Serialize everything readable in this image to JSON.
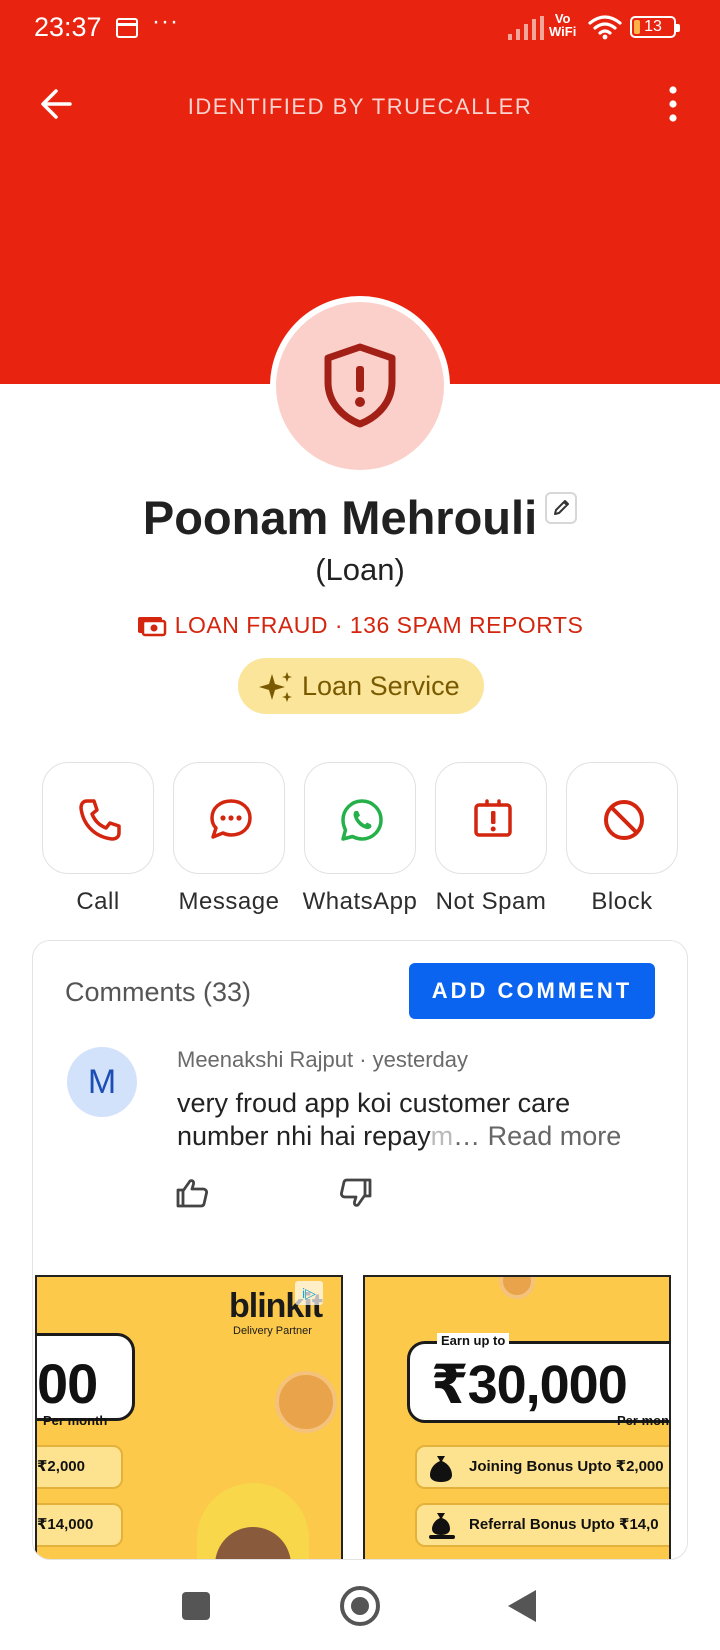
{
  "status_bar": {
    "time": "23:37",
    "overflow": "···",
    "network_label_top": "Vo",
    "network_label_bottom": "WiFi",
    "battery": "13"
  },
  "header": {
    "title": "IDENTIFIED BY TRUECALLER",
    "background_color": "#e8230f"
  },
  "profile": {
    "name": "Poonam Mehrouli",
    "subtitle": "(Loan)",
    "spam_label": "LOAN FRAUD · 136 SPAM REPORTS",
    "tag": "Loan Service",
    "avatar_icon": "shield-alert-icon"
  },
  "actions": [
    {
      "label": "Call",
      "icon": "phone-icon"
    },
    {
      "label": "Message",
      "icon": "chat-bubble-icon"
    },
    {
      "label": "WhatsApp",
      "icon": "whatsapp-icon"
    },
    {
      "label": "Not Spam",
      "icon": "not-spam-icon"
    },
    {
      "label": "Block",
      "icon": "block-icon"
    }
  ],
  "comments": {
    "title": "Comments (33)",
    "add_button": "ADD COMMENT",
    "items": [
      {
        "avatar_initial": "M",
        "author_time": "Meenakshi Rajput · yesterday",
        "text_line1": "very froud app koi customer care",
        "text_line2": "number nhi hai repay",
        "text_faded": "m",
        "read_more": "… Read more"
      }
    ]
  },
  "ads": {
    "left": {
      "logo": "blinkit",
      "sub": "Delivery Partner",
      "badge": "i▷",
      "amount": "00",
      "per_month": "Per month",
      "chip1": "₹2,000",
      "chip2": "₹14,000"
    },
    "right": {
      "earn": "Earn up to",
      "amount": "₹30,000",
      "per_month": "Per mon",
      "chip1": "Joining Bonus Upto ₹2,000",
      "chip2": "Referral Bonus Upto ₹14,0"
    }
  }
}
